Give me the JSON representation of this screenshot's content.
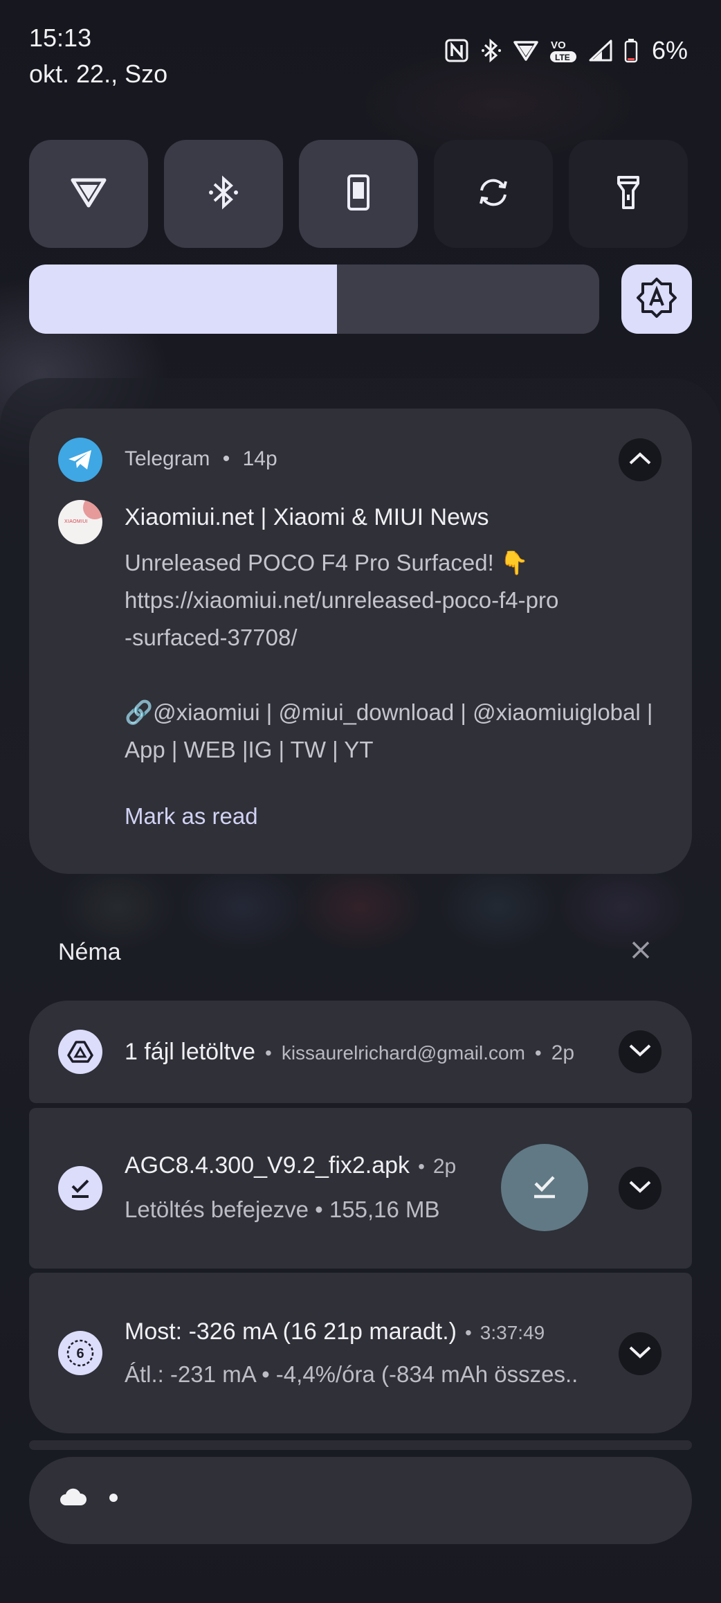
{
  "status_bar": {
    "time": "15:13",
    "date": "okt. 22., Szo",
    "battery_percent": "6%",
    "icons": [
      "nfc-icon",
      "bluetooth-icon",
      "wifi-icon",
      "volte-icon",
      "signal-icon",
      "battery-icon"
    ]
  },
  "quick_settings": {
    "tiles": [
      {
        "name": "wifi-icon",
        "active": true
      },
      {
        "name": "bluetooth-icon",
        "active": true
      },
      {
        "name": "phone-mode-icon",
        "active": true
      },
      {
        "name": "auto-rotate-icon",
        "active": false
      },
      {
        "name": "flashlight-icon",
        "active": false
      }
    ],
    "brightness_level": 0.54,
    "auto_brightness_icon": "auto-brightness-icon"
  },
  "telegram_notification": {
    "app": "Telegram",
    "time": "14p",
    "sender": "Xiaomiui.net | Xiaomi & MIUI News",
    "avatar_text": "XIAOMIUI",
    "message": "Unreleased POCO F4 Pro Surfaced! 👇\nhttps://xiaomiui.net/unreleased-poco-f4-pro\n-surfaced-37708/\n\n🔗@xiaomiui | @miui_download | @xiaomiuiglobal |\nApp |  WEB |IG  | TW  | YT",
    "action": "Mark as read"
  },
  "silent_section": {
    "title": "Néma"
  },
  "notifications": [
    {
      "title": "1 fájl letöltve",
      "meta": "kissaurelrichard@gmail.com",
      "time": "2p",
      "icon": "google-drive-icon"
    },
    {
      "title": "AGC8.4.300_V9.2_fix2.apk",
      "time": "2p",
      "subtitle": "Letöltés befejezve • 155,16 MB",
      "icon": "download-done-icon"
    },
    {
      "title": "Most: -326 mA (16 21p maradt.)",
      "time": "3:37:49",
      "subtitle": "Átl.: -231 mA • -4,4%/óra (-834 mAh összes..",
      "icon": "battery-monitor-icon",
      "icon_text": "6"
    }
  ],
  "separator": "•",
  "bottom_notification": {
    "icon": "cloud-icon"
  }
}
